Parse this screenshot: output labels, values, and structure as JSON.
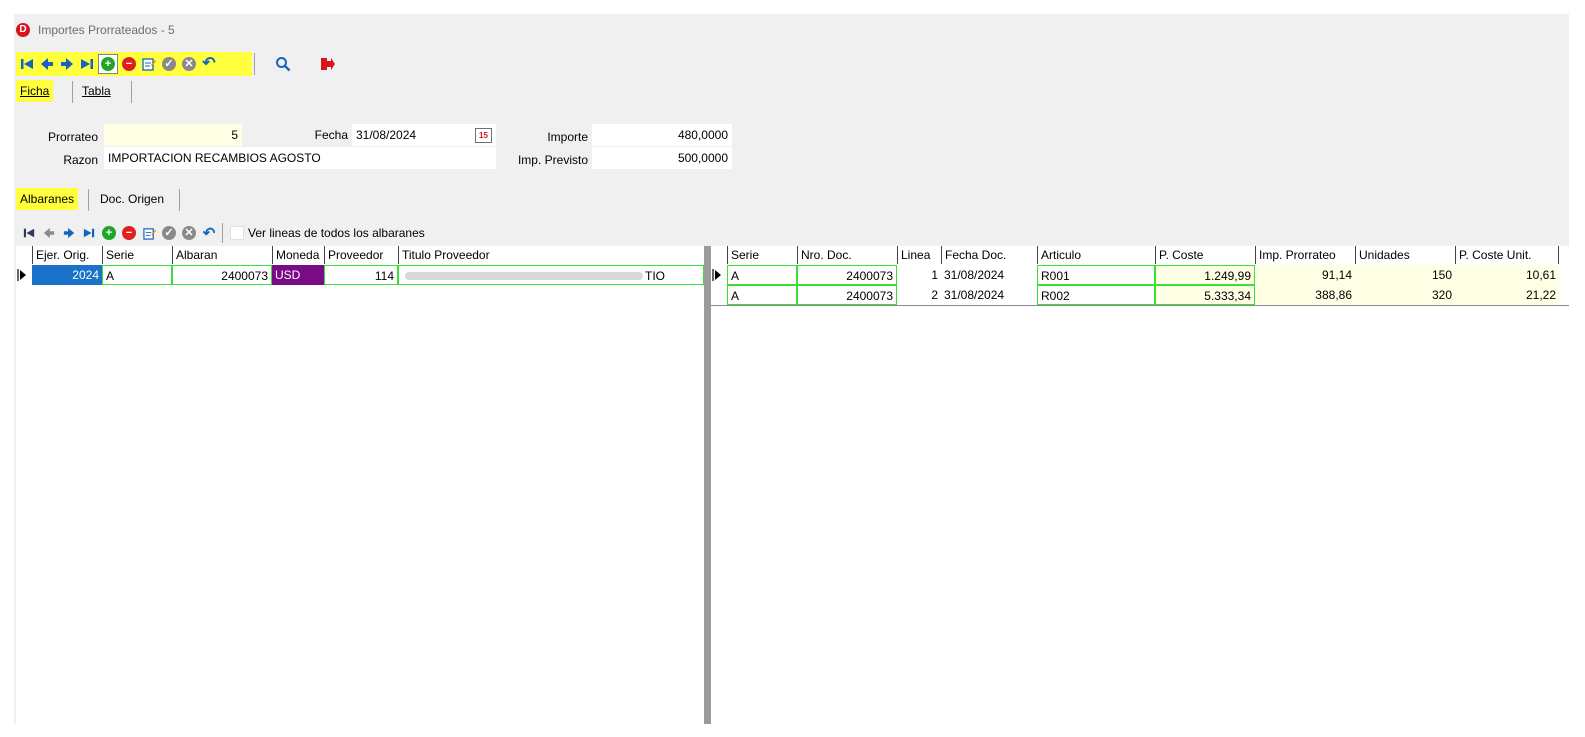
{
  "window": {
    "logo_letter": "D",
    "title": "Importes Prorrateados -   5"
  },
  "main_toolbar": {
    "icons": [
      "first-record-icon",
      "prev-record-icon",
      "next-record-icon",
      "last-record-icon",
      "add-record-icon",
      "delete-record-icon",
      "edit-record-icon",
      "confirm-icon",
      "cancel-icon",
      "undo-icon",
      "search-icon",
      "exit-icon"
    ]
  },
  "view_tabs": [
    {
      "label": "Ficha",
      "active": true
    },
    {
      "label": "Tabla",
      "active": false
    }
  ],
  "form": {
    "prorrateo_label": "Prorrateo",
    "prorrateo_value": "5",
    "fecha_label": "Fecha",
    "fecha_value": "31/08/2024",
    "calendar_day": "15",
    "importe_label": "Importe",
    "importe_value": "480,0000",
    "razon_label": "Razon",
    "razon_value": "IMPORTACION RECAMBIOS AGOSTO",
    "imp_previsto_label": "Imp. Previsto",
    "imp_previsto_value": "500,0000"
  },
  "detail_tabs": [
    {
      "label": "Albaranes",
      "active": true
    },
    {
      "label": "Doc. Origen",
      "active": false
    }
  ],
  "detail_toolbar": {
    "checkbox_label": "Ver lineas de todos los albaranes",
    "checkbox_checked": false
  },
  "albaranes_grid": {
    "columns": [
      "Ejer. Orig.",
      "Serie",
      "Albaran",
      "Moneda",
      "Proveedor",
      "Titulo Proveedor"
    ],
    "rows": [
      {
        "ejer": "2024",
        "serie": "A",
        "albaran": "2400073",
        "moneda": "USD",
        "proveedor": "114",
        "titulo_tail": "TIO"
      }
    ]
  },
  "lineas_grid": {
    "columns": [
      "Serie",
      "Nro. Doc.",
      "Linea",
      "Fecha Doc.",
      "Articulo",
      "P. Coste",
      "Imp. Prorrateo",
      "Unidades",
      "P. Coste Unit."
    ],
    "rows": [
      {
        "serie": "A",
        "nro_doc": "2400073",
        "linea": "1",
        "fecha": "31/08/2024",
        "articulo": "R001",
        "p_coste": "1.249,99",
        "imp_prorrateo": "91,14",
        "unidades": "150",
        "p_coste_unit": "10,61"
      },
      {
        "serie": "A",
        "nro_doc": "2400073",
        "linea": "2",
        "fecha": "31/08/2024",
        "articulo": "R002",
        "p_coste": "5.333,34",
        "imp_prorrateo": "388,86",
        "unidades": "320",
        "p_coste_unit": "21,22"
      }
    ]
  },
  "colors": {
    "highlight": "#ffff3d",
    "selected_cell": "#1a73c8",
    "currency_cell": "#7a0a86",
    "cell_border": "#38e038",
    "cream": "#ffffe6"
  }
}
